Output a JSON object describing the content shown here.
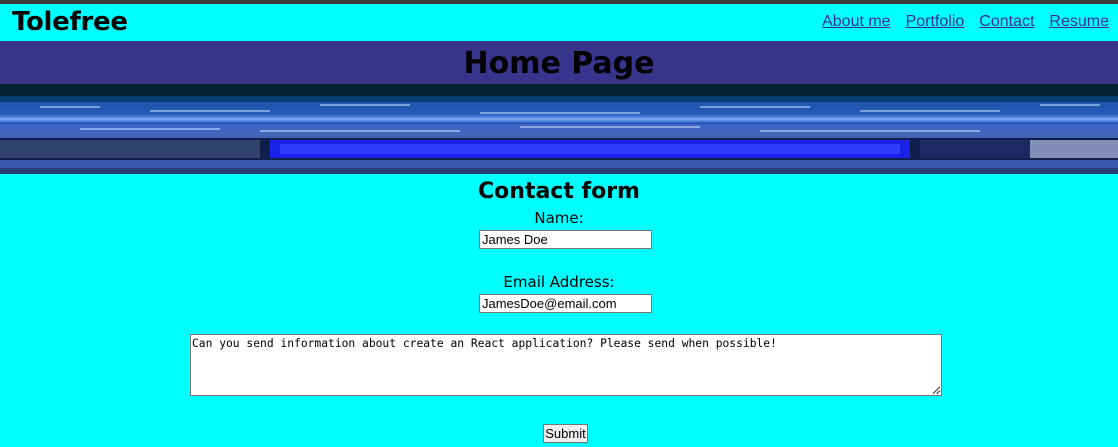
{
  "brand": "Tolefree",
  "nav": {
    "links": [
      "About me",
      "Portfolio",
      "Contact",
      "Resume"
    ]
  },
  "page_title": "Home Page",
  "contact_form": {
    "heading": "Contact form",
    "name_label": "Name:",
    "name_value": "James Doe",
    "email_label": "Email Address:",
    "email_value": "JamesDoe@email.com",
    "message_value": "Can you send information about create an React application? Please send when possible!",
    "submit_label": "Submit"
  },
  "colors": {
    "page_background": "#00ffff",
    "title_bar": "#37348c",
    "link": "#3a2d96"
  }
}
